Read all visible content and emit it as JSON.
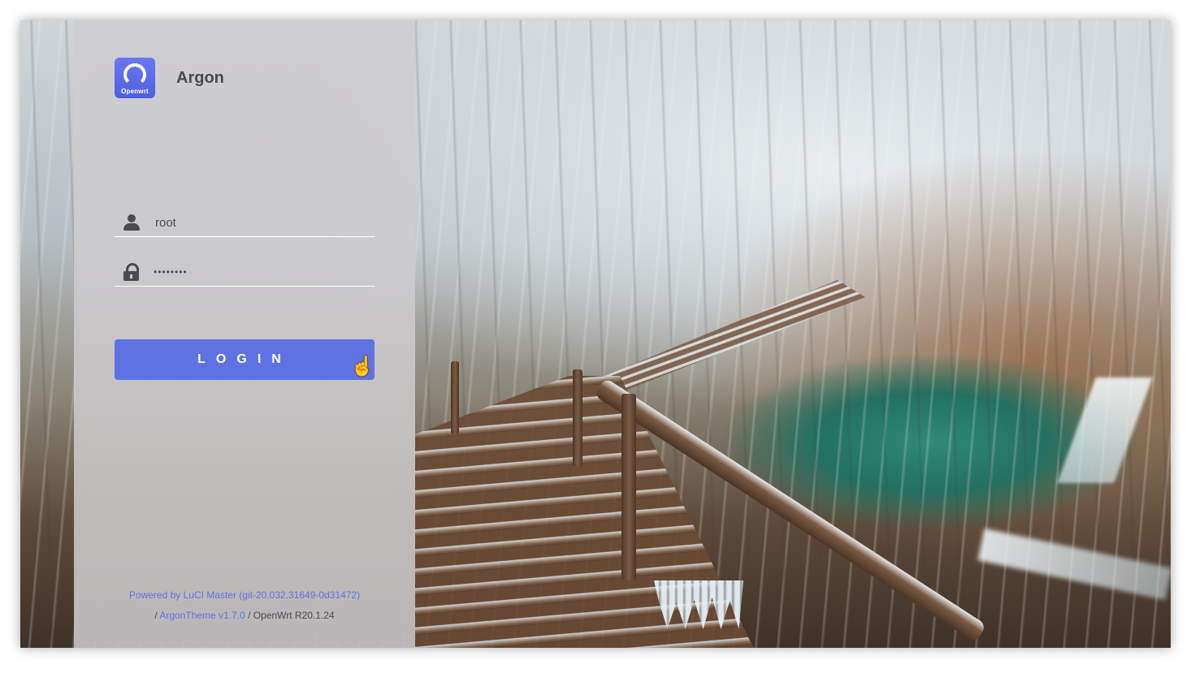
{
  "brand": {
    "logo_text": "Openwrt",
    "name": "Argon"
  },
  "login_form": {
    "username_value": "root",
    "password_value": "••••••••",
    "username_icon": "user-icon",
    "password_icon": "lock-icon",
    "login_label": "LOGIN"
  },
  "footer": {
    "powered_by": "Powered by LuCI Master (git-20.032.31649-0d31472)",
    "separator_1": "/",
    "theme": "ArgonTheme v1.7.0",
    "separator_2": "/",
    "os_version": "OpenWrt R20.1.24"
  },
  "colors": {
    "accent": "#5e72e4",
    "panel": "#cecccedb",
    "text": "#4a4a55"
  }
}
